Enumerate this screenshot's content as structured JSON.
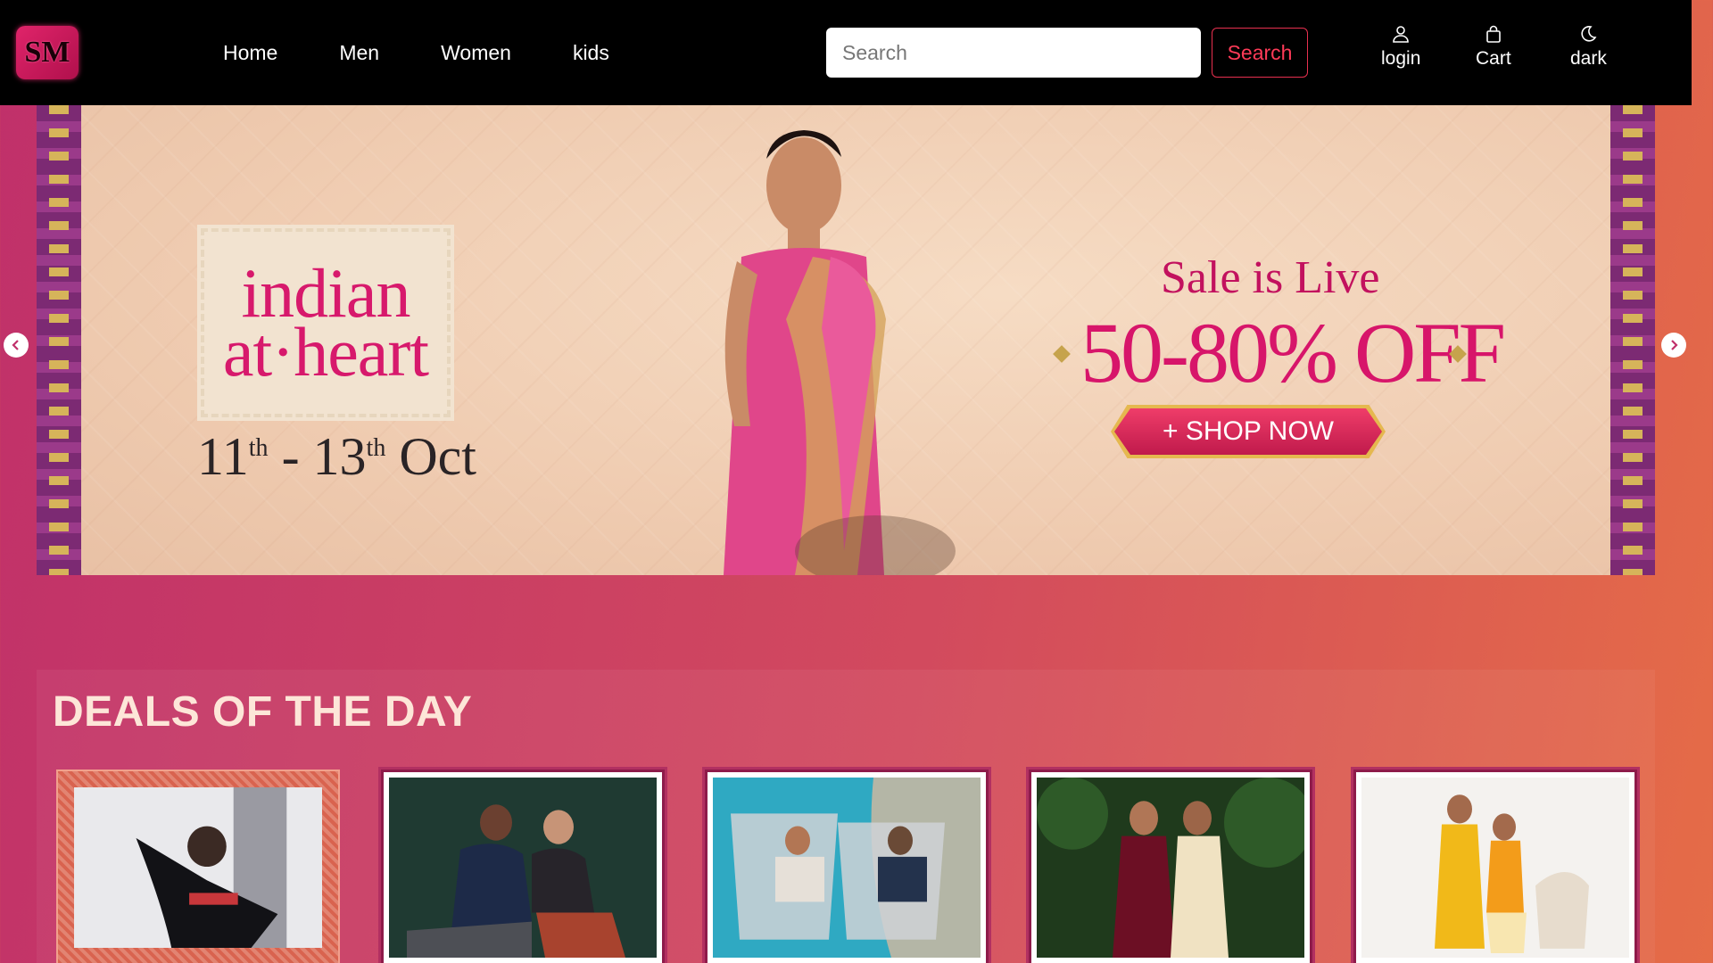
{
  "navbar": {
    "logo_text": "SM",
    "links": [
      "Home",
      "Men",
      "Women",
      "kids"
    ],
    "search": {
      "placeholder": "Search",
      "button_label": "Search"
    },
    "icons": [
      {
        "icon": "user-icon",
        "label": "login"
      },
      {
        "icon": "bag-icon",
        "label": "Cart"
      },
      {
        "icon": "moon-icon",
        "label": "dark"
      }
    ]
  },
  "banner": {
    "headline_line1": "indian",
    "headline_line2": "at·heart",
    "date_start_day": "11",
    "date_start_suffix": "th",
    "date_separator": " - ",
    "date_end_day": "13",
    "date_end_suffix": "th",
    "date_month": " Oct",
    "sale_title": "Sale is Live",
    "sale_offer": "50-80% OFF",
    "shop_button": "+ SHOP NOW"
  },
  "deals": {
    "title": "DEALS OF THE DAY",
    "cards": [
      {
        "subject": "man in black outfit dancing"
      },
      {
        "subject": "couple in winter wear"
      },
      {
        "subject": "two men lounging by a pool"
      },
      {
        "subject": "two women in ethnic wear"
      },
      {
        "subject": "two kids in yellow ethnic wear"
      }
    ]
  },
  "colors": {
    "accent": "#d7196c",
    "navbar_bg": "#000000",
    "search_button": "#ff3b58",
    "gradient_start": "#c0306a",
    "gradient_end": "#e56c47"
  }
}
